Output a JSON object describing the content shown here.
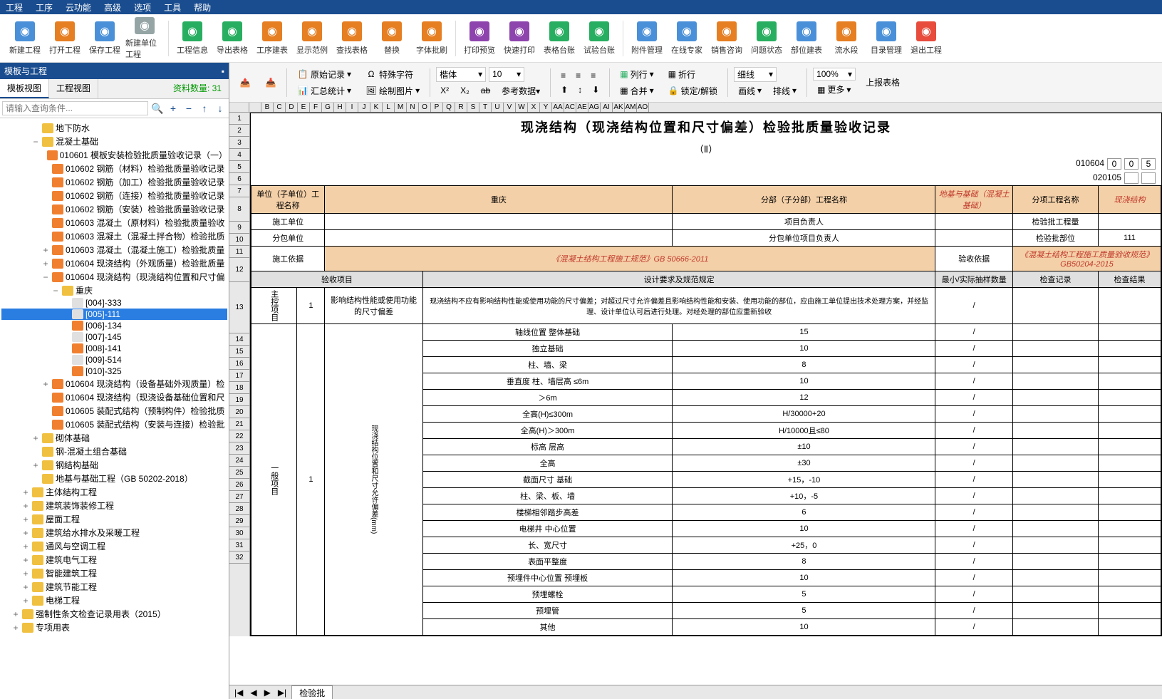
{
  "menu": [
    "工程",
    "工序",
    "云功能",
    "高级",
    "选项",
    "工具",
    "帮助"
  ],
  "toolbar": [
    {
      "label": "新建工程",
      "cls": ""
    },
    {
      "label": "打开工程",
      "cls": "orange"
    },
    {
      "label": "保存工程",
      "cls": ""
    },
    {
      "label": "新建单位工程",
      "cls": "gray"
    },
    {
      "label": "工程信息",
      "cls": "green"
    },
    {
      "label": "导出表格",
      "cls": "green"
    },
    {
      "label": "工序建表",
      "cls": "orange"
    },
    {
      "label": "显示范例",
      "cls": "orange"
    },
    {
      "label": "查找表格",
      "cls": "orange"
    },
    {
      "label": "替换",
      "cls": "orange"
    },
    {
      "label": "字体批刷",
      "cls": "orange"
    },
    {
      "label": "打印预览",
      "cls": "purple"
    },
    {
      "label": "快速打印",
      "cls": "purple"
    },
    {
      "label": "表格台账",
      "cls": "green"
    },
    {
      "label": "试验台账",
      "cls": "green"
    },
    {
      "label": "附件管理",
      "cls": ""
    },
    {
      "label": "在线专家",
      "cls": ""
    },
    {
      "label": "销售咨询",
      "cls": "orange"
    },
    {
      "label": "问题状态",
      "cls": "green"
    },
    {
      "label": "部位建表",
      "cls": ""
    },
    {
      "label": "流水段",
      "cls": "orange"
    },
    {
      "label": "目录管理",
      "cls": ""
    },
    {
      "label": "退出工程",
      "cls": "red"
    }
  ],
  "side": {
    "title": "模板与工程",
    "tabs": [
      "模板视图",
      "工程视图"
    ],
    "count": "资料数量: 31",
    "search": "请输入查询条件...",
    "tree": [
      {
        "ind": 3,
        "exp": "",
        "ico": "folder",
        "label": "地下防水"
      },
      {
        "ind": 3,
        "exp": "−",
        "ico": "folder",
        "label": "混凝土基础"
      },
      {
        "ind": 4,
        "exp": "",
        "ico": "check",
        "label": "010601 模板安装检验批质量验收记录（一）"
      },
      {
        "ind": 4,
        "exp": "",
        "ico": "check",
        "label": "010602 钢筋（材料）检验批质量验收记录"
      },
      {
        "ind": 4,
        "exp": "",
        "ico": "check",
        "label": "010602 钢筋（加工）检验批质量验收记录"
      },
      {
        "ind": 4,
        "exp": "",
        "ico": "check",
        "label": "010602 钢筋（连接）检验批质量验收记录"
      },
      {
        "ind": 4,
        "exp": "",
        "ico": "check",
        "label": "010602 钢筋（安装）检验批质量验收记录"
      },
      {
        "ind": 4,
        "exp": "",
        "ico": "check",
        "label": "010603 混凝土（原材料）检验批质量验收"
      },
      {
        "ind": 4,
        "exp": "",
        "ico": "check",
        "label": "010603 混凝土（混凝土拌合物）检验批质"
      },
      {
        "ind": 4,
        "exp": "+",
        "ico": "check",
        "label": "010603 混凝土（混凝土施工）检验批质量"
      },
      {
        "ind": 4,
        "exp": "+",
        "ico": "check",
        "label": "010604 现浇结构（外观质量）检验批质量"
      },
      {
        "ind": 4,
        "exp": "−",
        "ico": "check",
        "label": "010604 现浇结构（现浇结构位置和尺寸偏"
      },
      {
        "ind": 5,
        "exp": "−",
        "ico": "folder",
        "label": "重庆"
      },
      {
        "ind": 6,
        "exp": "",
        "ico": "file",
        "label": "[004]-333"
      },
      {
        "ind": 6,
        "exp": "",
        "ico": "file",
        "label": "[005]-111",
        "sel": true
      },
      {
        "ind": 6,
        "exp": "",
        "ico": "check",
        "label": "[006]-134"
      },
      {
        "ind": 6,
        "exp": "",
        "ico": "file",
        "label": "[007]-145"
      },
      {
        "ind": 6,
        "exp": "",
        "ico": "check",
        "label": "[008]-141"
      },
      {
        "ind": 6,
        "exp": "",
        "ico": "file",
        "label": "[009]-514"
      },
      {
        "ind": 6,
        "exp": "",
        "ico": "check",
        "label": "[010]-325"
      },
      {
        "ind": 4,
        "exp": "+",
        "ico": "check",
        "label": "010604 现浇结构（设备基础外观质量）检"
      },
      {
        "ind": 4,
        "exp": "",
        "ico": "check",
        "label": "010604 现浇结构（现浇设备基础位置和尺"
      },
      {
        "ind": 4,
        "exp": "",
        "ico": "check",
        "label": "010605 装配式结构（预制构件）检验批质"
      },
      {
        "ind": 4,
        "exp": "",
        "ico": "check",
        "label": "010605 装配式结构（安装与连接）检验批"
      },
      {
        "ind": 3,
        "exp": "+",
        "ico": "folder",
        "label": "砌体基础"
      },
      {
        "ind": 3,
        "exp": "",
        "ico": "folder",
        "label": "钢-混凝土组合基础"
      },
      {
        "ind": 3,
        "exp": "+",
        "ico": "folder",
        "label": "钢结构基础"
      },
      {
        "ind": 3,
        "exp": "",
        "ico": "folder",
        "label": "地基与基础工程（GB 50202-2018）"
      },
      {
        "ind": 2,
        "exp": "+",
        "ico": "folder",
        "label": "主体结构工程"
      },
      {
        "ind": 2,
        "exp": "+",
        "ico": "folder",
        "label": "建筑装饰装修工程"
      },
      {
        "ind": 2,
        "exp": "+",
        "ico": "folder",
        "label": "屋面工程"
      },
      {
        "ind": 2,
        "exp": "+",
        "ico": "folder",
        "label": "建筑给水排水及采暖工程"
      },
      {
        "ind": 2,
        "exp": "+",
        "ico": "folder",
        "label": "通风与空调工程"
      },
      {
        "ind": 2,
        "exp": "+",
        "ico": "folder",
        "label": "建筑电气工程"
      },
      {
        "ind": 2,
        "exp": "+",
        "ico": "folder",
        "label": "智能建筑工程"
      },
      {
        "ind": 2,
        "exp": "+",
        "ico": "folder",
        "label": "建筑节能工程"
      },
      {
        "ind": 2,
        "exp": "+",
        "ico": "folder",
        "label": "电梯工程"
      },
      {
        "ind": 1,
        "exp": "+",
        "ico": "folder",
        "label": "强制性条文检查记录用表（2015）"
      },
      {
        "ind": 1,
        "exp": "+",
        "ico": "folder",
        "label": "专项用表"
      }
    ]
  },
  "ribbon": {
    "btns1": [
      "原始记录",
      "特殊字符"
    ],
    "btns2": [
      "汇总统计",
      "绘制图片"
    ],
    "font": "楷体",
    "size": "10",
    "align": "列行",
    "merge": "合并",
    "wrap": "折行",
    "lock": "锁定/解锁",
    "line": "细线",
    "thick": "画线",
    "swap": "排线",
    "zoom": "100%",
    "upload": "上报表格",
    "more": "更多"
  },
  "cols": [
    "",
    "B",
    "C",
    "D",
    "E",
    "F",
    "G",
    "H",
    "I",
    "J",
    "K",
    "L",
    "M",
    "N",
    "O",
    "P",
    "Q",
    "R",
    "S",
    "T",
    "U",
    "V",
    "W",
    "X",
    "Y",
    "AA",
    "AC",
    "AE",
    "AG",
    "AI",
    "AK",
    "AM",
    "AO"
  ],
  "doc": {
    "title": "现浇结构（现浇结构位置和尺寸偏差）检验批质量验收记录",
    "sub": "（Ⅱ）",
    "code1": "010604",
    "code2": "0",
    "code3": "0",
    "code4": "5",
    "code5": "020105",
    "r1": {
      "a": "单位（子单位）工程名称",
      "b": "重庆",
      "c": "分部（子分部）工程名称",
      "d": "地基与基础（混凝土基础）",
      "e": "分项工程名称",
      "f": "现浇结构"
    },
    "r2": {
      "a": "施工单位",
      "b": "",
      "c": "项目负责人",
      "d": "",
      "e": "检验批工程量",
      "f": ""
    },
    "r3": {
      "a": "分包单位",
      "b": "",
      "c": "分包单位项目负责人",
      "d": "",
      "e": "检验批部位",
      "f": "111"
    },
    "r4": {
      "a": "施工依据",
      "b": "《混凝土结构工程施工规范》GB 50666-2011",
      "c": "验收依据",
      "d": "《混凝土结构工程施工质量验收规范》GB50204-2015"
    },
    "hdr": {
      "a": "验收项目",
      "b": "设计要求及规范规定",
      "c": "最小/实际抽样数量",
      "d": "检查记录",
      "e": "检查结果"
    },
    "main_label": "主控项目",
    "main_no": "1",
    "main_item": "影响结构性能或使用功能的尺寸偏差",
    "main_desc": "现浇结构不应有影响结构性能或使用功能的尺寸偏差；对超过尺寸允许偏差且影响结构性能和安装、使用功能的部位，应由施工单位提出技术处理方案，并经监理、设计单位认可后进行处理。对经处理的部位应重新验收",
    "gen_label": "一般项目",
    "gen_no": "1",
    "gen_item": "现浇结构位置和尺寸允许偏差(mm)",
    "rows": [
      {
        "cat": "轴线位置",
        "sub": "整体基础",
        "val": "15"
      },
      {
        "cat": "",
        "sub": "独立基础",
        "val": "10"
      },
      {
        "cat": "",
        "sub": "柱、墙、梁",
        "val": "8"
      },
      {
        "cat": "垂直度",
        "sub": "柱、墙层高 ≤6m",
        "val": "10"
      },
      {
        "cat": "",
        "sub": "＞6m",
        "val": "12"
      },
      {
        "cat": "",
        "sub": "全高(H)≤300m",
        "val": "H/30000+20"
      },
      {
        "cat": "",
        "sub": "全高(H)＞300m",
        "val": "H/10000且≤80"
      },
      {
        "cat": "标高",
        "sub": "层高",
        "val": "±10"
      },
      {
        "cat": "",
        "sub": "全高",
        "val": "±30"
      },
      {
        "cat": "截面尺寸",
        "sub": "基础",
        "val": "+15，-10"
      },
      {
        "cat": "",
        "sub": "柱、梁、板、墙",
        "val": "+10，-5"
      },
      {
        "cat": "",
        "sub": "楼梯相邻踏步高差",
        "val": "6"
      },
      {
        "cat": "电梯井",
        "sub": "中心位置",
        "val": "10"
      },
      {
        "cat": "",
        "sub": "长、宽尺寸",
        "val": "+25，0"
      },
      {
        "cat": "表面平整度",
        "sub": "",
        "val": "8"
      },
      {
        "cat": "预埋件中心位置",
        "sub": "预埋板",
        "val": "10"
      },
      {
        "cat": "",
        "sub": "预埋螺栓",
        "val": "5"
      },
      {
        "cat": "",
        "sub": "预埋管",
        "val": "5"
      },
      {
        "cat": "",
        "sub": "其他",
        "val": "10"
      }
    ]
  },
  "sheettab": "检验批"
}
